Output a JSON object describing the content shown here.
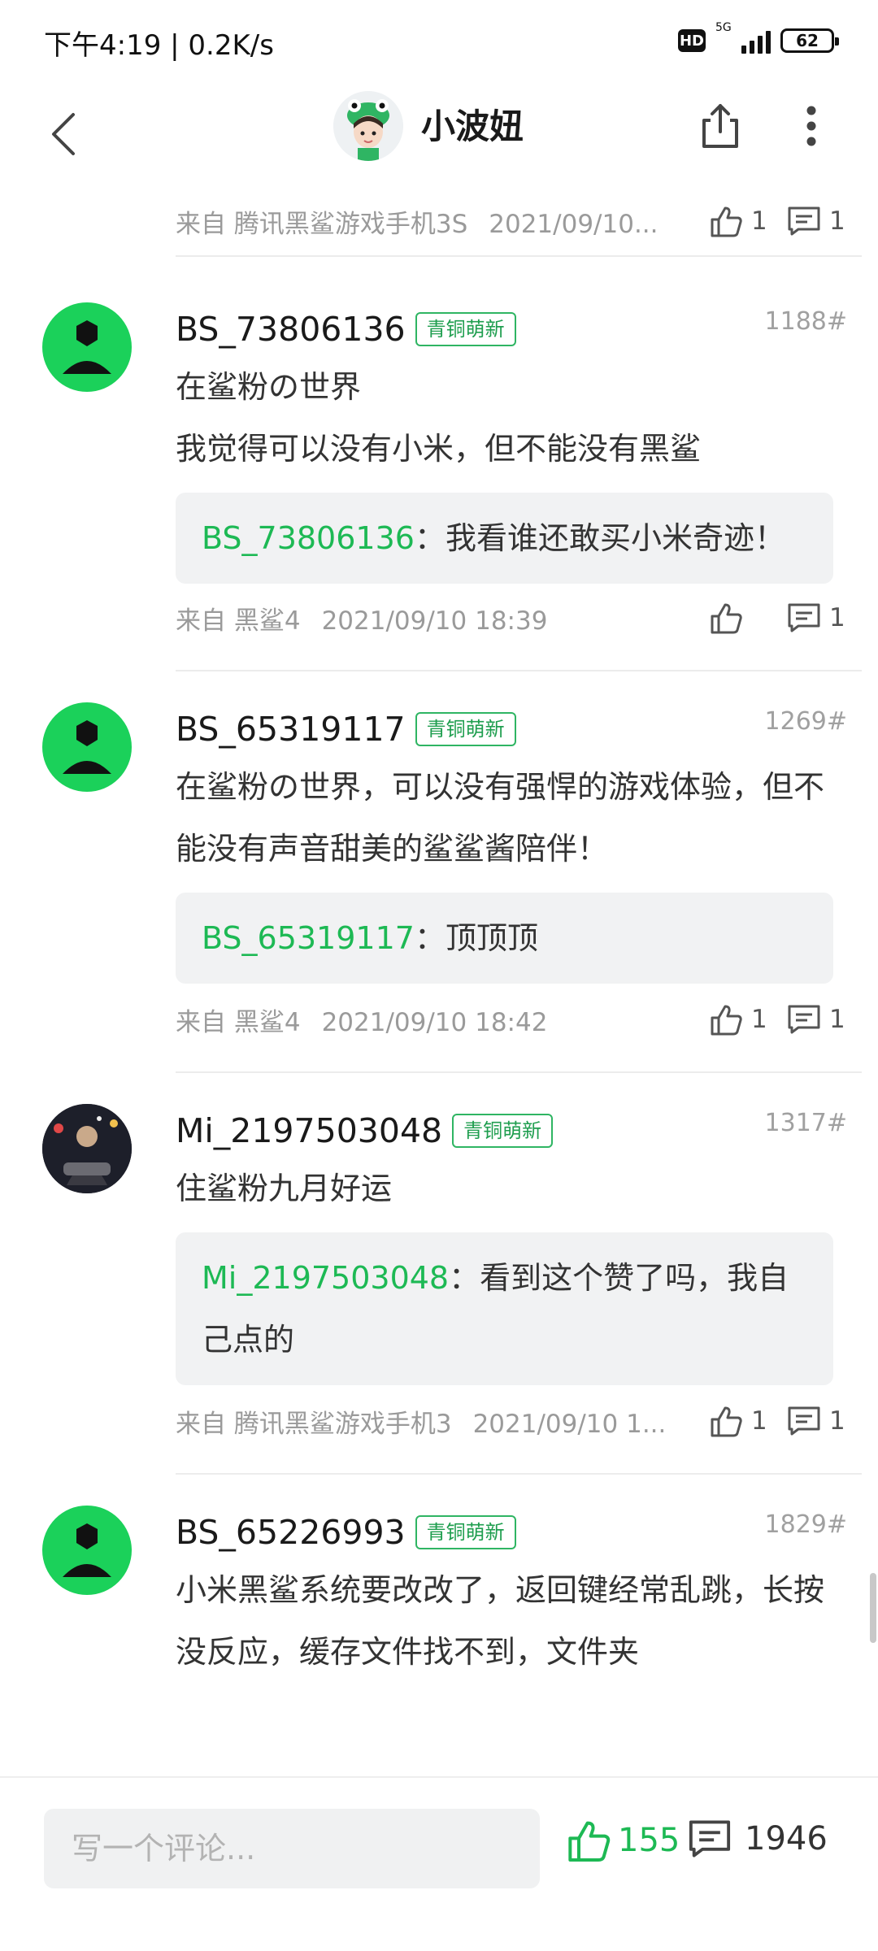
{
  "status_bar": {
    "time_speed": "下午4:19 | 0.2K/s",
    "hd": "HD",
    "network": "5G",
    "battery": "62"
  },
  "header": {
    "title": "小波妞"
  },
  "top_meta": {
    "device": "来自 腾讯黑鲨游戏手机3S",
    "time": "2021/09/10...",
    "likes": "1",
    "replies": "1"
  },
  "comments": [
    {
      "name": "BS_73806136",
      "badge": "青铜萌新",
      "floor": "1188#",
      "body_lines": [
        "在鲨粉の世界",
        "我觉得可以没有小米，但不能没有黑鲨"
      ],
      "reply_name": "BS_73806136",
      "reply_sep": "：",
      "reply_text": "我看谁还敢买小米奇迹！",
      "device": "来自 黑鲨4",
      "time": "2021/09/10 18:39",
      "likes": "",
      "replies": "1"
    },
    {
      "name": "BS_65319117",
      "badge": "青铜萌新",
      "floor": "1269#",
      "body_lines": [
        "在鲨粉の世界，可以没有强悍的游戏体验，但不能没有声音甜美的鲨鲨酱陪伴！"
      ],
      "reply_name": "BS_65319117",
      "reply_sep": "：",
      "reply_text": "顶顶顶",
      "device": "来自 黑鲨4",
      "time": "2021/09/10 18:42",
      "likes": "1",
      "replies": "1"
    },
    {
      "name": "Mi_2197503048",
      "badge": "青铜萌新",
      "floor": "1317#",
      "body_lines": [
        "住鲨粉九月好运"
      ],
      "reply_name": "Mi_2197503048",
      "reply_sep": "：",
      "reply_text": "看到这个赞了吗，我自己点的",
      "device": "来自 腾讯黑鲨游戏手机3",
      "time": "2021/09/10 1...",
      "likes": "1",
      "replies": "1"
    },
    {
      "name": "BS_65226993",
      "badge": "青铜萌新",
      "floor": "1829#",
      "body_lines": [
        "小米黑鲨系统要改改了，返回键经常乱跳，长按没反应，缓存文件找不到，文件夹"
      ]
    }
  ],
  "bottom_bar": {
    "input_placeholder": "写一个评论...",
    "likes": "155",
    "comments": "1946"
  },
  "colors": {
    "accent_green": "#1db954",
    "badge_green": "#2fb563",
    "avatar_green": "#1bd15a",
    "reply_bg": "#f1f2f3"
  }
}
